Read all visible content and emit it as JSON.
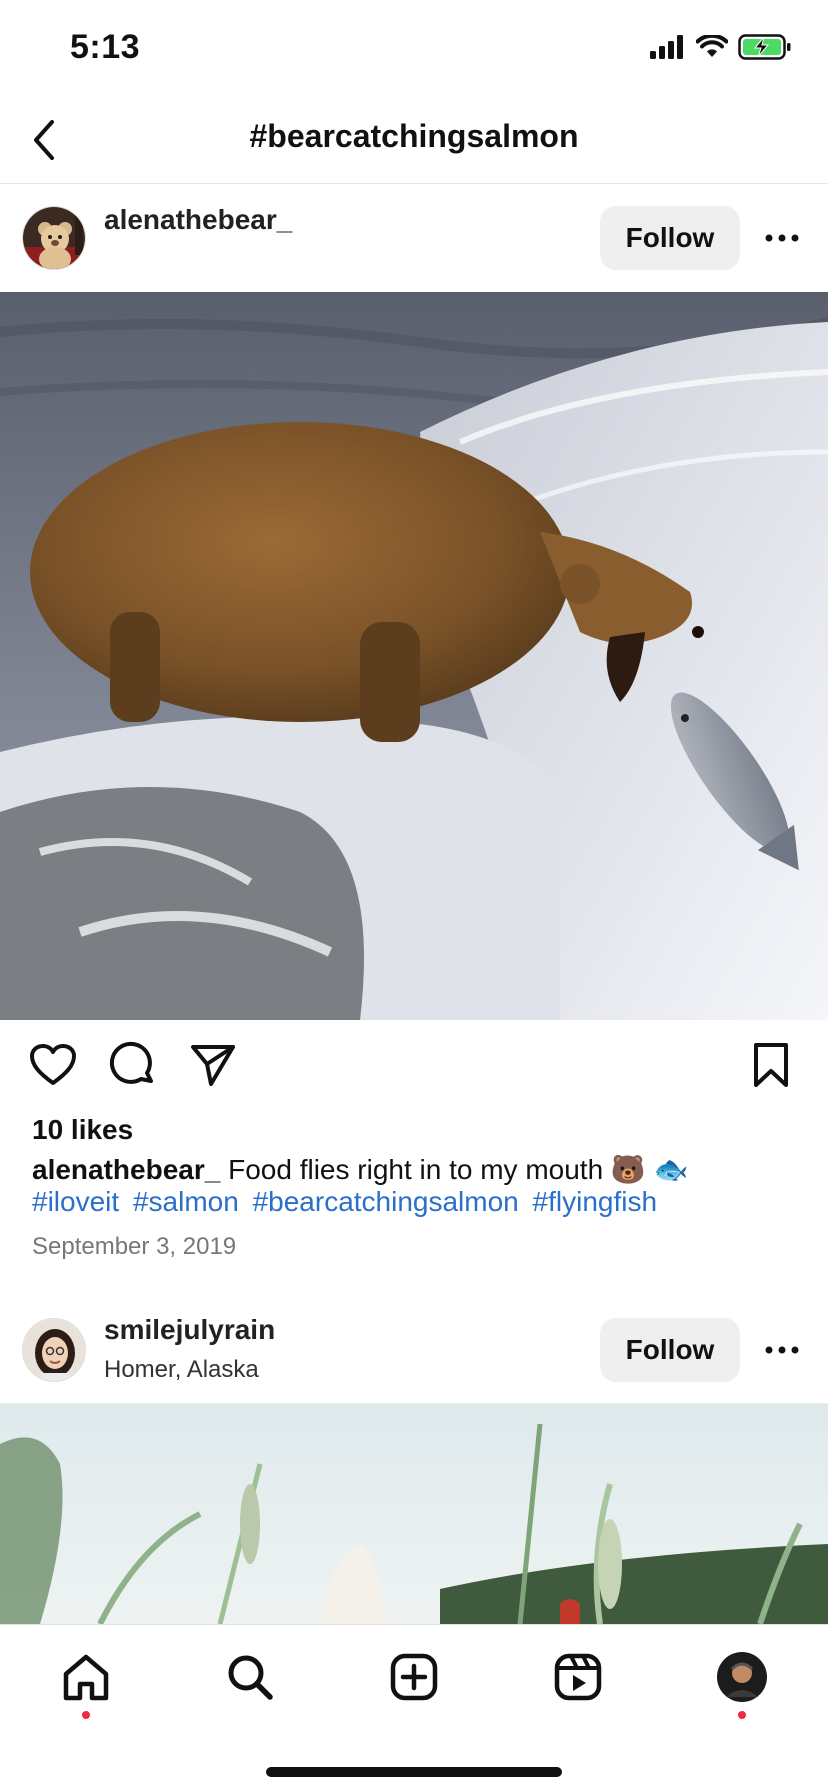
{
  "status_bar": {
    "time": "5:13",
    "icons": [
      "cellular-signal-icon",
      "wifi-icon",
      "battery-charging-icon"
    ],
    "battery_color": "#4cd964"
  },
  "nav": {
    "title": "#bearcatchingsalmon",
    "back_icon": "chevron-left-icon"
  },
  "posts": [
    {
      "username": "alenathebear_",
      "location": "",
      "follow_label": "Follow",
      "more_icon": "ellipsis-icon",
      "image": "photo of a brown bear at a waterfall catching a leaping salmon",
      "likes": "10 likes",
      "caption_user": "alenathebear_",
      "caption_text": " Food flies right in to my mouth 🐻 🐟",
      "hashtags": [
        "#iloveit",
        "#salmon",
        "#bearcatchingsalmon",
        "#flyingfish"
      ],
      "date": "September 3, 2019"
    },
    {
      "username": "smilejulyrain",
      "location": "Homer, Alaska",
      "follow_label": "Follow",
      "more_icon": "ellipsis-icon",
      "image": "photo of tall grass with a distant shoreline"
    }
  ],
  "actions": {
    "like_icon": "heart-icon",
    "comment_icon": "comment-icon",
    "share_icon": "send-icon",
    "save_icon": "bookmark-icon"
  },
  "tab_bar": {
    "tabs": [
      "home-icon",
      "search-icon",
      "create-icon",
      "reels-icon",
      "profile-avatar"
    ],
    "notification_color": "#ed2d3b"
  },
  "colors": {
    "hashtag": "#2a6fc9",
    "follow_bg": "#efefef"
  }
}
